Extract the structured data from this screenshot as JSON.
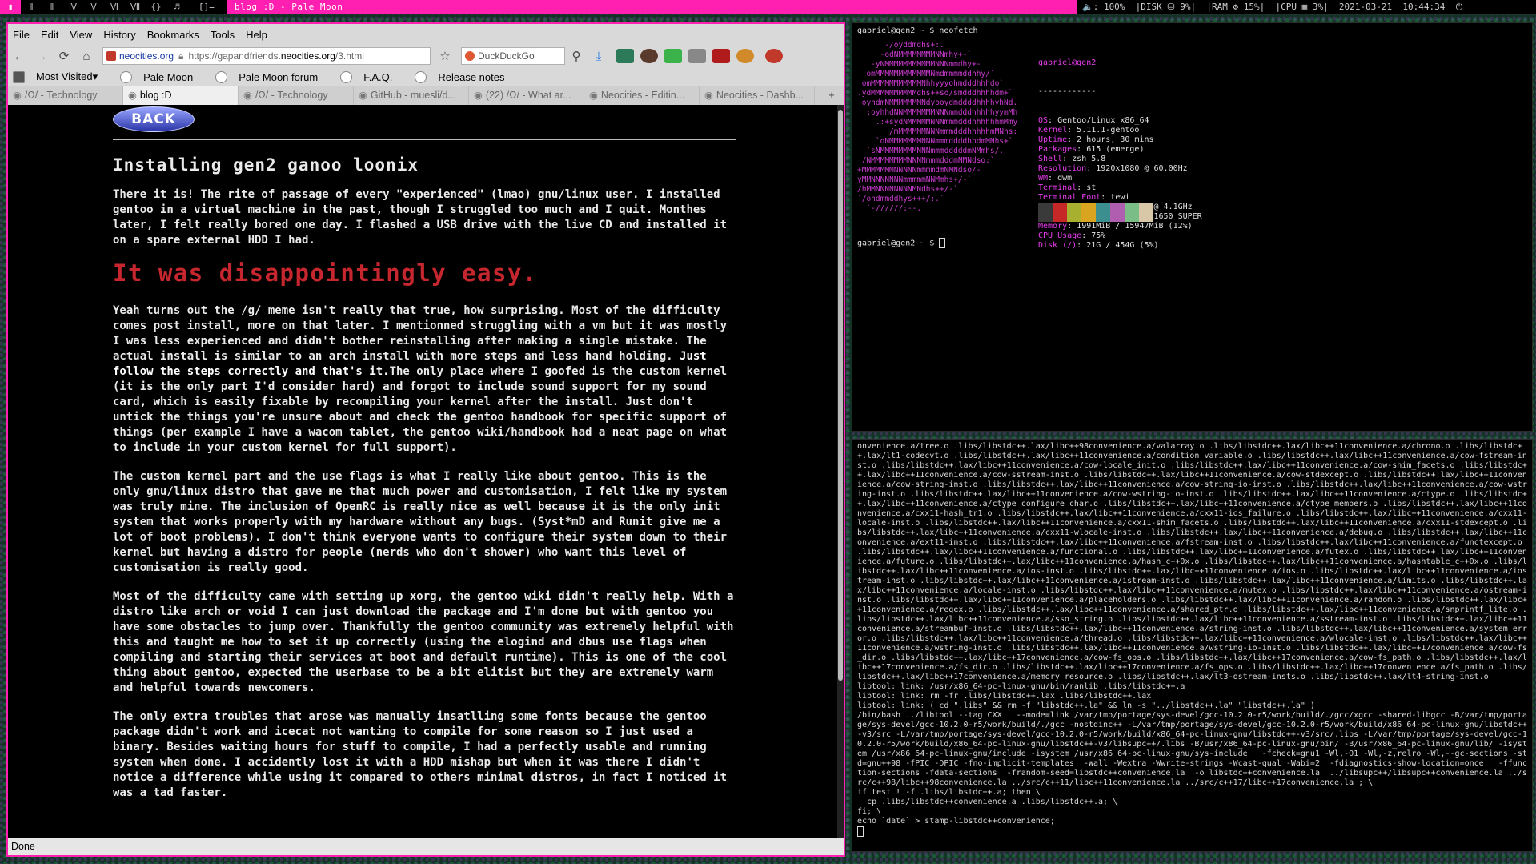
{
  "topbar": {
    "tags": [
      "▮",
      "Ⅱ",
      "Ⅲ",
      "Ⅳ",
      "Ⅴ",
      "Ⅵ",
      "Ⅶ",
      "{}",
      "♬"
    ],
    "layout": "[]=",
    "window_title": "blog :D - Pale Moon",
    "status": "🔈: 100%  |DISK ⛁ 9%|  |RAM ⚙ 15%|  |CPU ▦ 3%|  2021-03-21  10:44:34  ⏻"
  },
  "browser": {
    "menu": [
      "File",
      "Edit",
      "View",
      "History",
      "Bookmarks",
      "Tools",
      "Help"
    ],
    "nav": {
      "back": "←",
      "forward": "→",
      "reload": "⟳",
      "home": "⌂"
    },
    "site_identity": "neocities.org",
    "url_prefix": "https://gapandfriends.",
    "url_domain": "neocities.org",
    "url_path": "/3.html",
    "search_engine": "DuckDuckGo",
    "bookmarks": [
      "Most Visited▾",
      "Pale Moon",
      "Pale Moon forum",
      "F.A.Q.",
      "Release notes"
    ],
    "tabs": [
      {
        "label": "/Ω/ - Technology",
        "active": false
      },
      {
        "label": "blog :D",
        "active": true
      },
      {
        "label": "/Ω/ - Technology",
        "active": false
      },
      {
        "label": "GitHub - muesli/d...",
        "active": false
      },
      {
        "label": "(22) /Ω/ - What ar...",
        "active": false
      },
      {
        "label": "Neocities - Editin...",
        "active": false
      },
      {
        "label": "Neocities - Dashb...",
        "active": false
      }
    ],
    "new_tab": "+",
    "status_text": "Done"
  },
  "page": {
    "back_label": "BACK",
    "title": "Installing gen2 ganoo loonix",
    "p1": "There it is! The rite of passage of every \"experienced\" (lmao) gnu/linux user. I installed gentoo in a virtual machine in the past, though I struggled too much and I quit. Monthes later, I felt really bored one day. I flashed a USB drive with the live CD and installed it on a spare external HDD I had.",
    "subtitle": "It was disappointingly easy.",
    "p2a": "Yeah turns out the /g/ meme isn't really that true, how surprising. Most of the difficulty comes post install, more on that later. I mentionned struggling with a vm but it was mostly I was less experienced and didn't bother reinstalling after making a single mistake. The actual install is similar to an arch install with more steps and less hand holding. ",
    "p2b": "Just follow the steps correctly and that's it.",
    "p2c": "The only place where I goofed is the custom kernel (it is the only part I'd consider hard) and forgot to include sound support for my sound card, which is easily fixable by recompiling your kernel after the install. Just don't untick the things you're unsure about and check the gentoo handbook for specific support of things (per example I have a wacom tablet, the gentoo wiki/handbook had a neat page on what to include in your custom kernel for full support).",
    "p3": "The custom kernel part and the use flags is what I really like about gentoo. This is the only gnu/linux distro that gave me that much power and customisation, I felt like my system was truly mine. The inclusion of OpenRC is really nice as well because it is the only init system that works properly with my hardware without any bugs. (Syst*mD and Runit give me a lot of boot problems). I don't think everyone wants to configure their system down to their kernel but having a distro for people (nerds who don't shower) who want this level of customisation is really good.",
    "p4": "Most of the difficulty came with setting up xorg, the gentoo wiki didn't really help. With a distro like arch or void I can just download the package and I'm done but with gentoo you have some obstacles to jump over. Thankfully the gentoo community was extremely helpful with this and taught me how to set it up correctly (using the elogind and dbus use flags when compiling and starting their services at boot and default runtime). This is one of the cool thing about gentoo, expected the userbase to be a bit elitist but they are extremely warm and helpful towards newcomers.",
    "p5": "The only extra troubles that arose was manually insatlling some fonts because the gentoo package didn't work and icecat not wanting to compile for some reason so I just used a binary. Besides waiting hours for stuff to compile, I had a perfectly usable and running system when done. I accidently lost it with a HDD mishap but when it was there I didn't notice a difference while using it compared to others minimal distros, in fact I noticed it was a tad faster."
  },
  "term1": {
    "prompt_cmd": "gabriel@gen2 ~ $ neofetch",
    "user_host": "gabriel@gen2",
    "separator": "------------",
    "info": [
      {
        "k": "OS",
        "v": "Gentoo/Linux x86_64"
      },
      {
        "k": "Kernel",
        "v": "5.11.1-gentoo"
      },
      {
        "k": "Uptime",
        "v": "2 hours, 30 mins"
      },
      {
        "k": "Packages",
        "v": "615 (emerge)"
      },
      {
        "k": "Shell",
        "v": "zsh 5.8"
      },
      {
        "k": "Resolution",
        "v": "1920x1080 @ 60.00Hz"
      },
      {
        "k": "WM",
        "v": "dwm"
      },
      {
        "k": "Terminal",
        "v": "st"
      },
      {
        "k": "Terminal Font",
        "v": "tewi"
      },
      {
        "k": "CPU",
        "v": "Intel i5-9400F (6) @ 4.1GHz"
      },
      {
        "k": "GPU",
        "v": "NVIDIA GeForce GTX 1650 SUPER"
      },
      {
        "k": "Memory",
        "v": "1991MiB / 15947MiB (12%)"
      },
      {
        "k": "CPU Usage",
        "v": "75%"
      },
      {
        "k": "Disk (/)",
        "v": "21G / 454G (5%)"
      }
    ],
    "swatch_colors": [
      "#3a3a3a",
      "#c62828",
      "#a8b030",
      "#d9a521",
      "#3c8f8f",
      "#b05fb0",
      "#7bbd86",
      "#d8c8a8"
    ],
    "prompt2": "gabriel@gen2 ~ $ "
  },
  "term2": {
    "text": "onvenience.a/tree.o .libs/libstdc++.lax/libc++98convenience.a/valarray.o .libs/libstdc++.lax/libc++11convenience.a/chrono.o .libs/libstdc++.lax/lt1-codecvt.o .libs/libstdc++.lax/libc++11convenience.a/condition_variable.o .libs/libstdc++.lax/libc++11convenience.a/cow-fstream-inst.o .libs/libstdc++.lax/libc++11convenience.a/cow-locale_init.o .libs/libstdc++.lax/libc++11convenience.a/cow-shim_facets.o .libs/libstdc++.lax/libc++11convenience.a/cow-sstream-inst.o .libs/libstdc++.lax/libc++11convenience.a/cow-stdexcept.o .libs/libstdc++.lax/libc++11convenience.a/cow-string-inst.o .libs/libstdc++.lax/libc++11convenience.a/cow-string-io-inst.o .libs/libstdc++.lax/libc++11convenience.a/cow-wstring-inst.o .libs/libstdc++.lax/libc++11convenience.a/cow-wstring-io-inst.o .libs/libstdc++.lax/libc++11convenience.a/ctype.o .libs/libstdc++.lax/libc++11convenience.a/ctype_configure_char.o .libs/libstdc++.lax/libc++11convenience.a/ctype_members.o .libs/libstdc++.lax/libc++11convenience.a/cxx11-hash_tr1.o .libs/libstdc++.lax/libc++11convenience.a/cxx11-ios_failure.o .libs/libstdc++.lax/libc++11convenience.a/cxx11-locale-inst.o .libs/libstdc++.lax/libc++11convenience.a/cxx11-shim_facets.o .libs/libstdc++.lax/libc++11convenience.a/cxx11-stdexcept.o .libs/libstdc++.lax/libc++11convenience.a/cxx11-wlocale-inst.o .libs/libstdc++.lax/libc++11convenience.a/debug.o .libs/libstdc++.lax/libc++11convenience.a/ext11-inst.o .libs/libstdc++.lax/libc++11convenience.a/fstream-inst.o .libs/libstdc++.lax/libc++11convenience.a/functexcept.o .libs/libstdc++.lax/libc++11convenience.a/functional.o .libs/libstdc++.lax/libc++11convenience.a/futex.o .libs/libstdc++.lax/libc++11convenience.a/future.o .libs/libstdc++.lax/libc++11convenience.a/hash_c++0x.o .libs/libstdc++.lax/libc++11convenience.a/hashtable_c++0x.o .libs/libstdc++.lax/libc++11convenience.a/ios-inst.o .libs/libstdc++.lax/libc++11convenience.a/ios.o .libs/libstdc++.lax/libc++11convenience.a/iostream-inst.o .libs/libstdc++.lax/libc++11convenience.a/istream-inst.o .libs/libstdc++.lax/libc++11convenience.a/limits.o .libs/libstdc++.lax/libc++11convenience.a/locale-inst.o .libs/libstdc++.lax/libc++11convenience.a/mutex.o .libs/libstdc++.lax/libc++11convenience.a/ostream-inst.o .libs/libstdc++.lax/libc++11convenience.a/placeholders.o .libs/libstdc++.lax/libc++11convenience.a/random.o .libs/libstdc++.lax/libc++11convenience.a/regex.o .libs/libstdc++.lax/libc++11convenience.a/shared_ptr.o .libs/libstdc++.lax/libc++11convenience.a/snprintf_lite.o .libs/libstdc++.lax/libc++11convenience.a/sso_string.o .libs/libstdc++.lax/libc++11convenience.a/sstream-inst.o .libs/libstdc++.lax/libc++11convenience.a/streambuf-inst.o .libs/libstdc++.lax/libc++11convenience.a/string-inst.o .libs/libstdc++.lax/libc++11convenience.a/system_error.o .libs/libstdc++.lax/libc++11convenience.a/thread.o .libs/libstdc++.lax/libc++11convenience.a/wlocale-inst.o .libs/libstdc++.lax/libc++11convenience.a/wstring-inst.o .libs/libstdc++.lax/libc++11convenience.a/wstring-io-inst.o .libs/libstdc++.lax/libc++17convenience.a/cow-fs_dir.o .libs/libstdc++.lax/libc++17convenience.a/cow-fs_ops.o .libs/libstdc++.lax/libc++17convenience.a/cow-fs_path.o .libs/libstdc++.lax/libc++17convenience.a/fs_dir.o .libs/libstdc++.lax/libc++17convenience.a/fs_ops.o .libs/libstdc++.lax/libc++17convenience.a/fs_path.o .libs/libstdc++.lax/libc++17convenience.a/memory_resource.o .libs/libstdc++.lax/lt3-ostream-insts.o .libs/libstdc++.lax/lt4-string-inst.o\nlibtool: link: /usr/x86_64-pc-linux-gnu/bin/ranlib .libs/libstdc++.a\nlibtool: link: rm -fr .libs/libstdc++.lax .libs/libstdc++.lax\nlibtool: link: ( cd \".libs\" && rm -f \"libstdc++.la\" && ln -s \"../libstdc++.la\" \"libstdc++.la\" )\n/bin/bash ../libtool --tag CXX   --mode=link /var/tmp/portage/sys-devel/gcc-10.2.0-r5/work/build/./gcc/xgcc -shared-libgcc -B/var/tmp/portage/sys-devel/gcc-10.2.0-r5/work/build/./gcc -nostdinc++ -L/var/tmp/portage/sys-devel/gcc-10.2.0-r5/work/build/x86_64-pc-linux-gnu/libstdc++-v3/src -L/var/tmp/portage/sys-devel/gcc-10.2.0-r5/work/build/x86_64-pc-linux-gnu/libstdc++-v3/src/.libs -L/var/tmp/portage/sys-devel/gcc-10.2.0-r5/work/build/x86_64-pc-linux-gnu/libstdc++-v3/libsupc++/.libs -B/usr/x86_64-pc-linux-gnu/bin/ -B/usr/x86_64-pc-linux-gnu/lib/ -isystem /usr/x86_64-pc-linux-gnu/include -isystem /usr/x86_64-pc-linux-gnu/sys-include   -fcheck=gnu1 -Wl,-O1 -Wl,-z,relro -Wl,--gc-sections -std=gnu++98 -fPIC -DPIC -fno-implicit-templates  -Wall -Wextra -Wwrite-strings -Wcast-qual -Wabi=2  -fdiagnostics-show-location=once   -ffunction-sections -fdata-sections  -frandom-seed=libstdc++convenience.la  -o libstdc++convenience.la  ../libsupc++/libsupc++convenience.la ../src/c++98/libc++98convenience.la ../src/c++11/libc++11convenience.la ../src/c++17/libc++17convenience.la ; \\\nif test ! -f .libs/libstdc++.a; then \\\n  cp .libs/libstdc++convenience.a .libs/libstdc++.a; \\\nfi; \\\necho `date` > stamp-libstdc++convenience;"
  }
}
